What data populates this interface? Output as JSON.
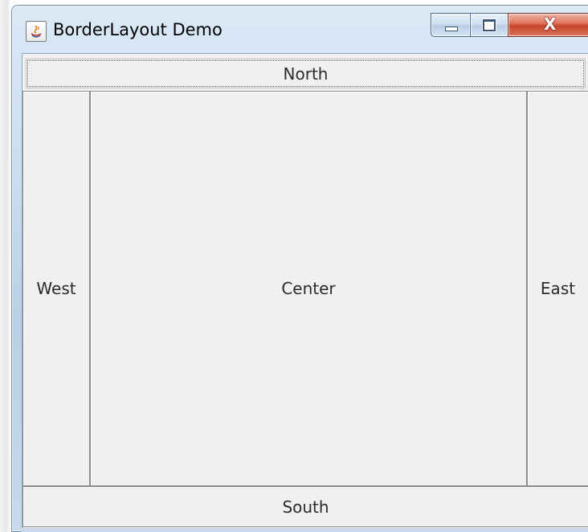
{
  "window": {
    "title": "BorderLayout Demo",
    "icon": "java-cup-icon",
    "controls": {
      "minimize": "minimize-icon",
      "maximize": "maximize-icon",
      "close_symbol": "X"
    }
  },
  "layout": {
    "north": "North",
    "west": "West",
    "center": "Center",
    "east": "East",
    "south": "South"
  },
  "colors": {
    "content_background": "#f0f0f0",
    "close_button": "#c7452a",
    "frame": "#c9dced"
  }
}
